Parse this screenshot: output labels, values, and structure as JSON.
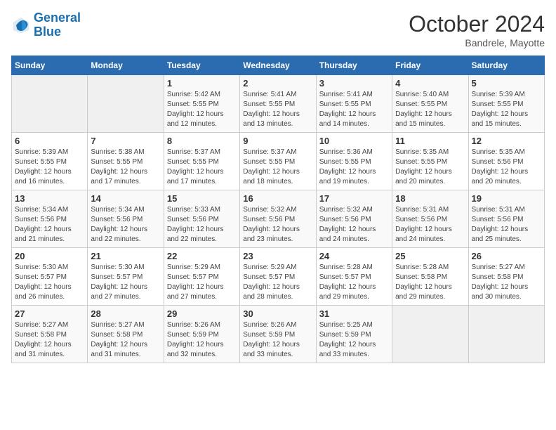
{
  "logo": {
    "line1": "General",
    "line2": "Blue"
  },
  "title": "October 2024",
  "subtitle": "Bandrele, Mayotte",
  "days_header": [
    "Sunday",
    "Monday",
    "Tuesday",
    "Wednesday",
    "Thursday",
    "Friday",
    "Saturday"
  ],
  "weeks": [
    [
      {
        "day": "",
        "info": ""
      },
      {
        "day": "",
        "info": ""
      },
      {
        "day": "1",
        "info": "Sunrise: 5:42 AM\nSunset: 5:55 PM\nDaylight: 12 hours\nand 12 minutes."
      },
      {
        "day": "2",
        "info": "Sunrise: 5:41 AM\nSunset: 5:55 PM\nDaylight: 12 hours\nand 13 minutes."
      },
      {
        "day": "3",
        "info": "Sunrise: 5:41 AM\nSunset: 5:55 PM\nDaylight: 12 hours\nand 14 minutes."
      },
      {
        "day": "4",
        "info": "Sunrise: 5:40 AM\nSunset: 5:55 PM\nDaylight: 12 hours\nand 15 minutes."
      },
      {
        "day": "5",
        "info": "Sunrise: 5:39 AM\nSunset: 5:55 PM\nDaylight: 12 hours\nand 15 minutes."
      }
    ],
    [
      {
        "day": "6",
        "info": "Sunrise: 5:39 AM\nSunset: 5:55 PM\nDaylight: 12 hours\nand 16 minutes."
      },
      {
        "day": "7",
        "info": "Sunrise: 5:38 AM\nSunset: 5:55 PM\nDaylight: 12 hours\nand 17 minutes."
      },
      {
        "day": "8",
        "info": "Sunrise: 5:37 AM\nSunset: 5:55 PM\nDaylight: 12 hours\nand 17 minutes."
      },
      {
        "day": "9",
        "info": "Sunrise: 5:37 AM\nSunset: 5:55 PM\nDaylight: 12 hours\nand 18 minutes."
      },
      {
        "day": "10",
        "info": "Sunrise: 5:36 AM\nSunset: 5:55 PM\nDaylight: 12 hours\nand 19 minutes."
      },
      {
        "day": "11",
        "info": "Sunrise: 5:35 AM\nSunset: 5:55 PM\nDaylight: 12 hours\nand 20 minutes."
      },
      {
        "day": "12",
        "info": "Sunrise: 5:35 AM\nSunset: 5:56 PM\nDaylight: 12 hours\nand 20 minutes."
      }
    ],
    [
      {
        "day": "13",
        "info": "Sunrise: 5:34 AM\nSunset: 5:56 PM\nDaylight: 12 hours\nand 21 minutes."
      },
      {
        "day": "14",
        "info": "Sunrise: 5:34 AM\nSunset: 5:56 PM\nDaylight: 12 hours\nand 22 minutes."
      },
      {
        "day": "15",
        "info": "Sunrise: 5:33 AM\nSunset: 5:56 PM\nDaylight: 12 hours\nand 22 minutes."
      },
      {
        "day": "16",
        "info": "Sunrise: 5:32 AM\nSunset: 5:56 PM\nDaylight: 12 hours\nand 23 minutes."
      },
      {
        "day": "17",
        "info": "Sunrise: 5:32 AM\nSunset: 5:56 PM\nDaylight: 12 hours\nand 24 minutes."
      },
      {
        "day": "18",
        "info": "Sunrise: 5:31 AM\nSunset: 5:56 PM\nDaylight: 12 hours\nand 24 minutes."
      },
      {
        "day": "19",
        "info": "Sunrise: 5:31 AM\nSunset: 5:56 PM\nDaylight: 12 hours\nand 25 minutes."
      }
    ],
    [
      {
        "day": "20",
        "info": "Sunrise: 5:30 AM\nSunset: 5:57 PM\nDaylight: 12 hours\nand 26 minutes."
      },
      {
        "day": "21",
        "info": "Sunrise: 5:30 AM\nSunset: 5:57 PM\nDaylight: 12 hours\nand 27 minutes."
      },
      {
        "day": "22",
        "info": "Sunrise: 5:29 AM\nSunset: 5:57 PM\nDaylight: 12 hours\nand 27 minutes."
      },
      {
        "day": "23",
        "info": "Sunrise: 5:29 AM\nSunset: 5:57 PM\nDaylight: 12 hours\nand 28 minutes."
      },
      {
        "day": "24",
        "info": "Sunrise: 5:28 AM\nSunset: 5:57 PM\nDaylight: 12 hours\nand 29 minutes."
      },
      {
        "day": "25",
        "info": "Sunrise: 5:28 AM\nSunset: 5:58 PM\nDaylight: 12 hours\nand 29 minutes."
      },
      {
        "day": "26",
        "info": "Sunrise: 5:27 AM\nSunset: 5:58 PM\nDaylight: 12 hours\nand 30 minutes."
      }
    ],
    [
      {
        "day": "27",
        "info": "Sunrise: 5:27 AM\nSunset: 5:58 PM\nDaylight: 12 hours\nand 31 minutes."
      },
      {
        "day": "28",
        "info": "Sunrise: 5:27 AM\nSunset: 5:58 PM\nDaylight: 12 hours\nand 31 minutes."
      },
      {
        "day": "29",
        "info": "Sunrise: 5:26 AM\nSunset: 5:59 PM\nDaylight: 12 hours\nand 32 minutes."
      },
      {
        "day": "30",
        "info": "Sunrise: 5:26 AM\nSunset: 5:59 PM\nDaylight: 12 hours\nand 33 minutes."
      },
      {
        "day": "31",
        "info": "Sunrise: 5:25 AM\nSunset: 5:59 PM\nDaylight: 12 hours\nand 33 minutes."
      },
      {
        "day": "",
        "info": ""
      },
      {
        "day": "",
        "info": ""
      }
    ]
  ]
}
